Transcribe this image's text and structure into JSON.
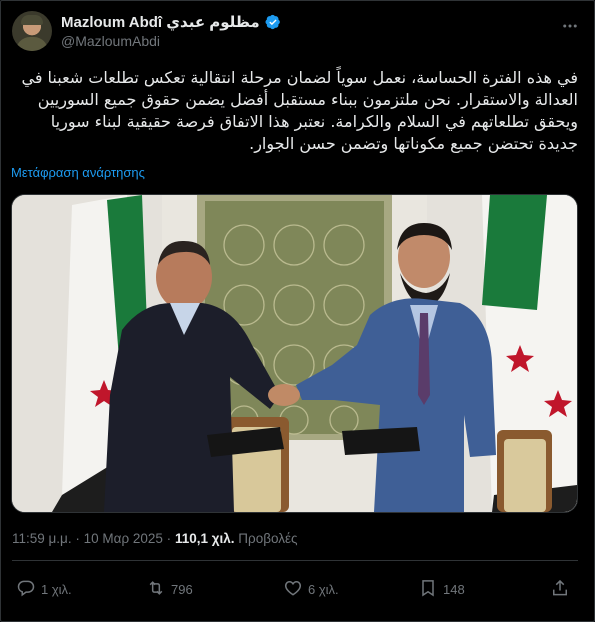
{
  "author": {
    "display_name": "Mazloum Abdî مظلوم عبدي",
    "handle": "@MazloumAbdi",
    "verified_icon": "verified-badge-icon"
  },
  "tweet": {
    "text": "في هذه الفترة الحساسة، نعمل سوياً لضمان مرحلة انتقالية تعكس تطلعات شعبنا في العدالة والاستقرار. نحن ملتزمون ببناء مستقبل أفضل يضمن حقوق جميع السوريين ويحقق تطلعاتهم في السلام والكرامة. نعتبر هذا الاتفاق فرصة حقيقية لبناء سوريا جديدة تحتضن جميع مكوناتها وتضمن حسن الجوار.",
    "translate_label": "Μετάφραση ανάρτησης"
  },
  "meta": {
    "time": "11:59 μ.μ.",
    "separator": "·",
    "date": "10 Μαρ 2025",
    "views_count": "110,1 χιλ.",
    "views_label": "Προβολές"
  },
  "actions": {
    "replies": "1 χιλ.",
    "reposts": "796",
    "likes": "6 χιλ.",
    "bookmarks": "148"
  },
  "colors": {
    "background": "#000000",
    "text": "#e7e9ea",
    "muted": "#71767b",
    "link": "#1d9bf0",
    "border": "#2f3336"
  }
}
